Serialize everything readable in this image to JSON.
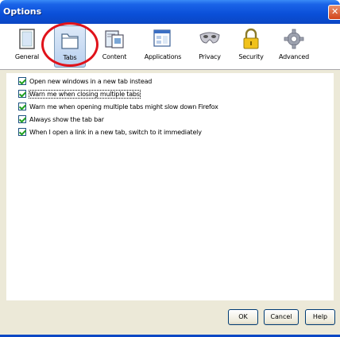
{
  "window": {
    "title": "Options",
    "close_glyph": "✕"
  },
  "toolbar": {
    "panes": [
      {
        "label": "General",
        "icon": "general-icon"
      },
      {
        "label": "Tabs",
        "icon": "tabs-icon",
        "selected": true
      },
      {
        "label": "Content",
        "icon": "content-icon"
      },
      {
        "label": "Applications",
        "icon": "applications-icon"
      },
      {
        "label": "Privacy",
        "icon": "privacy-mask-icon"
      },
      {
        "label": "Security",
        "icon": "security-lock-icon"
      },
      {
        "label": "Advanced",
        "icon": "advanced-gear-icon"
      }
    ]
  },
  "options": [
    {
      "label": "Open new windows in a new tab instead",
      "checked": true
    },
    {
      "label": "Warn me when closing multiple tabs",
      "checked": true
    },
    {
      "label": "Warn me when opening multiple tabs might slow down Firefox",
      "checked": true
    },
    {
      "label": "Always show the tab bar",
      "checked": true
    },
    {
      "label": "When I open a link in a new tab, switch to it immediately",
      "checked": true
    }
  ],
  "buttons": {
    "ok": "OK",
    "cancel": "Cancel",
    "help": "Help"
  },
  "colors": {
    "titlebar": "#0a4fd8",
    "highlight_ring": "#e0121a",
    "dialog_bg": "#ece9d8",
    "check": "#21a121"
  }
}
